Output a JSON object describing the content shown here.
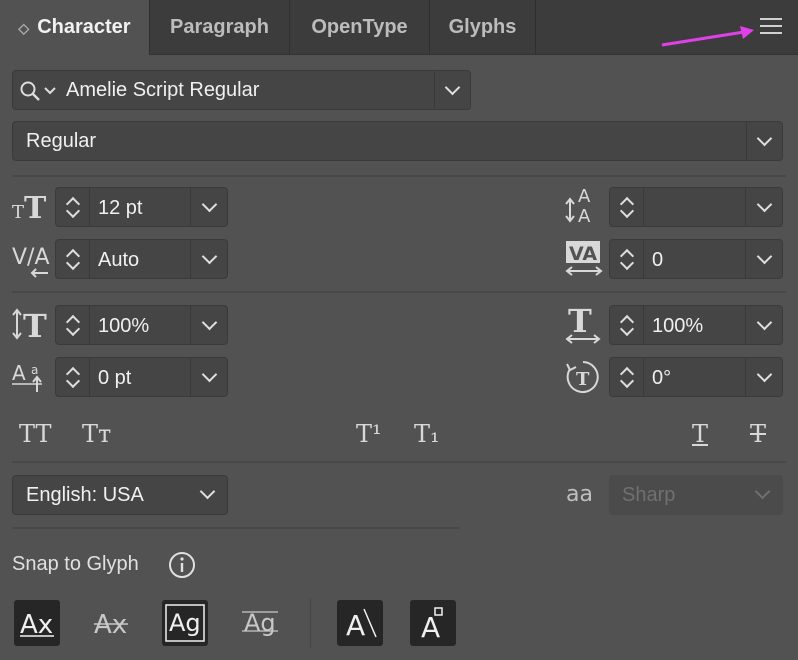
{
  "tabs": [
    {
      "label": "Character"
    },
    {
      "label": "Paragraph"
    },
    {
      "label": "OpenType"
    },
    {
      "label": "Glyphs"
    }
  ],
  "font": {
    "family": "Amelie Script Regular",
    "style": "Regular"
  },
  "left_fields": {
    "size": "12 pt",
    "kerning": "Auto",
    "vscale": "100%",
    "baseline": "0 pt"
  },
  "right_fields": {
    "leading": "",
    "tracking": "0",
    "hscale": "100%",
    "rotation": "0°"
  },
  "type_buttons": {
    "all_caps": "TT",
    "small_caps": "Tт",
    "superscript": "T¹",
    "subscript": "T₁",
    "underline": "T",
    "strike": "T"
  },
  "language": "English: USA",
  "anti_alias": {
    "value": "Sharp",
    "icon": "aa"
  },
  "snap": {
    "label": "Snap to Glyph"
  },
  "colors": {
    "bg": "#525252",
    "tabbar": "#3c3c3c",
    "arrow": "#e040e8"
  },
  "icons": [
    "search-icon",
    "menu-icon",
    "font-size-icon",
    "leading-icon",
    "kerning-icon",
    "tracking-icon",
    "vertical-scale-icon",
    "horizontal-scale-icon",
    "baseline-shift-icon",
    "rotation-icon",
    "info-icon"
  ]
}
